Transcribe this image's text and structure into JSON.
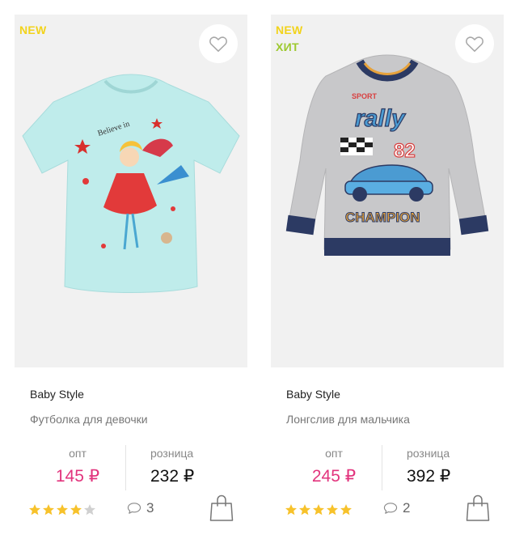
{
  "products": [
    {
      "badges": [
        "NEW"
      ],
      "brand": "Baby Style",
      "name": "Футболка для девочки",
      "price_labels": {
        "opt": "опт",
        "retail": "розница"
      },
      "opt_price": "145 ₽",
      "retail_price": "232 ₽",
      "rating": 4,
      "rating_max": 5,
      "comments": "3",
      "image_alt": "blue t-shirt with girl print",
      "shirt_color": "#bfeceb"
    },
    {
      "badges": [
        "NEW",
        "ХИТ"
      ],
      "brand": "Baby Style",
      "name": "Лонгслив для мальчика",
      "price_labels": {
        "opt": "опт",
        "retail": "розница"
      },
      "opt_price": "245 ₽",
      "retail_price": "392 ₽",
      "rating": 5,
      "rating_max": 5,
      "comments": "2",
      "image_alt": "grey longsleeve with rally car print",
      "shirt_color": "#c8c8ca"
    }
  ],
  "colors": {
    "accent_price": "#e2347d",
    "badge_new": "#f2d31b",
    "badge_hit": "#9dc92f",
    "star_filled": "#f7c22b",
    "star_empty": "#d0d0d0"
  },
  "icons": {
    "favorite": "heart-icon",
    "comments": "speech-bubble-icon",
    "cart": "shopping-bag-icon"
  }
}
